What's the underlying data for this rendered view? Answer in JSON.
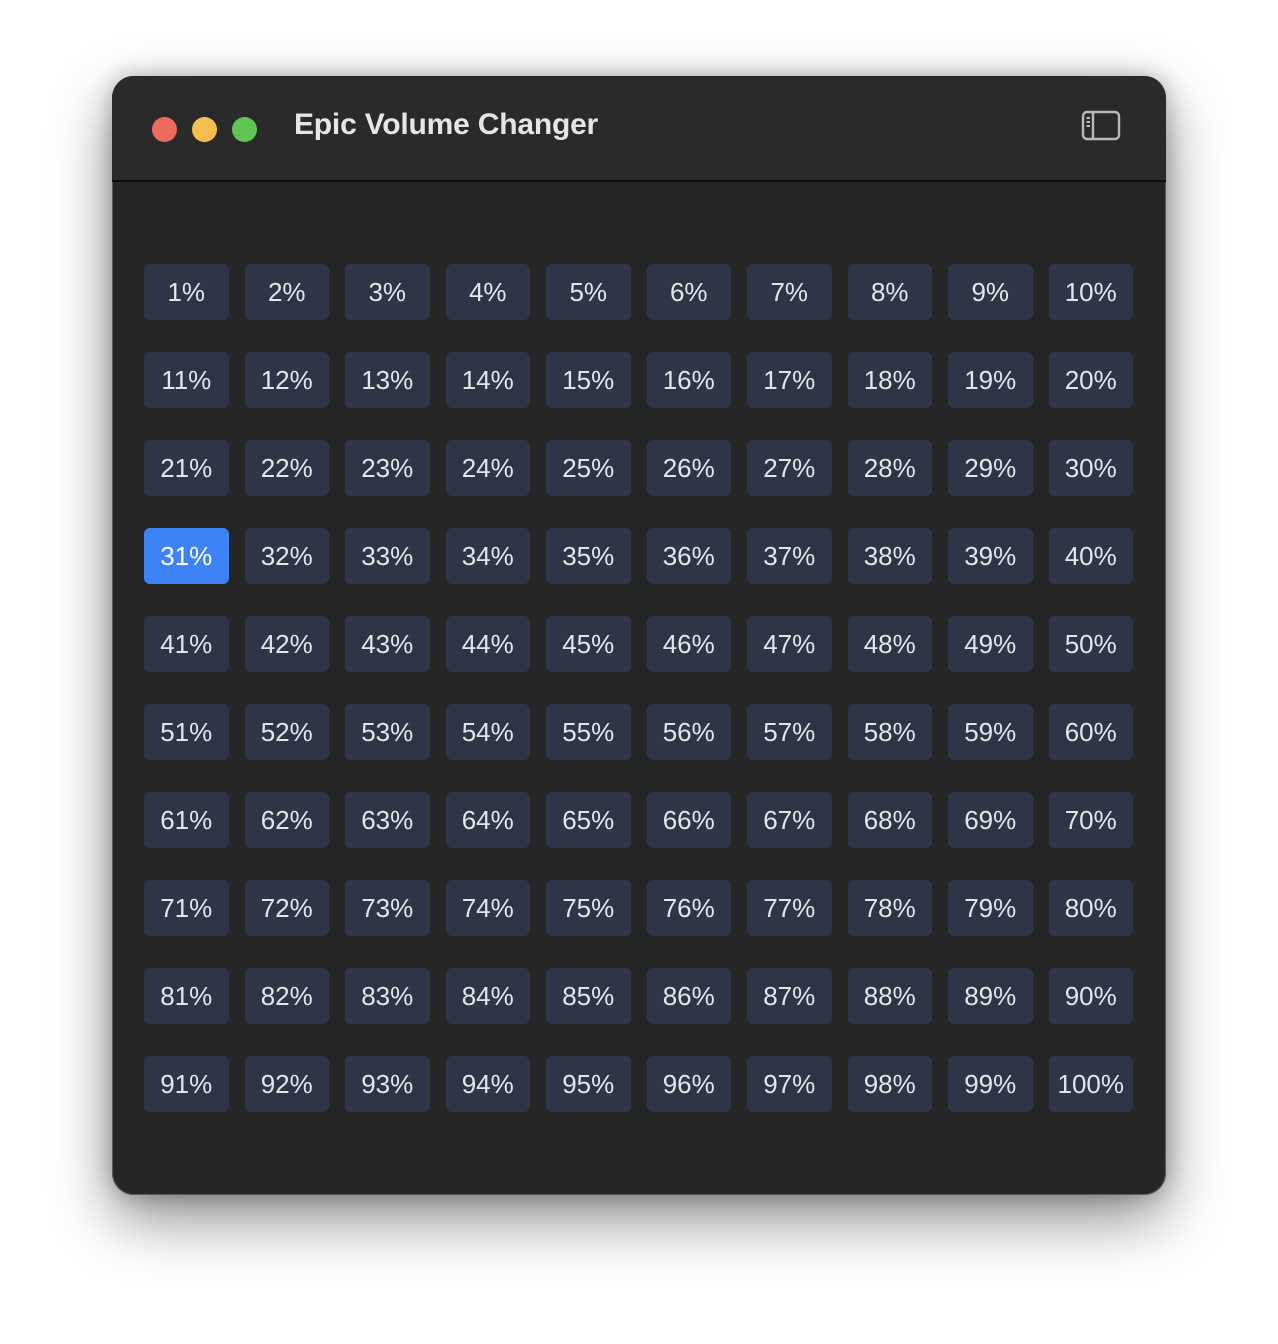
{
  "window": {
    "title": "Epic Volume Changer"
  },
  "toolbar": {
    "sidebar_toggle_icon": "sidebar-left-icon"
  },
  "colors": {
    "button_bg": "#2e3546",
    "selected_bg": "#3d82f7",
    "close": "#ed6a5e",
    "minimize": "#f5bf4f",
    "zoom": "#61c554"
  },
  "volume": {
    "selected": "31%",
    "options": [
      "1%",
      "2%",
      "3%",
      "4%",
      "5%",
      "6%",
      "7%",
      "8%",
      "9%",
      "10%",
      "11%",
      "12%",
      "13%",
      "14%",
      "15%",
      "16%",
      "17%",
      "18%",
      "19%",
      "20%",
      "21%",
      "22%",
      "23%",
      "24%",
      "25%",
      "26%",
      "27%",
      "28%",
      "29%",
      "30%",
      "31%",
      "32%",
      "33%",
      "34%",
      "35%",
      "36%",
      "37%",
      "38%",
      "39%",
      "40%",
      "41%",
      "42%",
      "43%",
      "44%",
      "45%",
      "46%",
      "47%",
      "48%",
      "49%",
      "50%",
      "51%",
      "52%",
      "53%",
      "54%",
      "55%",
      "56%",
      "57%",
      "58%",
      "59%",
      "60%",
      "61%",
      "62%",
      "63%",
      "64%",
      "65%",
      "66%",
      "67%",
      "68%",
      "69%",
      "70%",
      "71%",
      "72%",
      "73%",
      "74%",
      "75%",
      "76%",
      "77%",
      "78%",
      "79%",
      "80%",
      "81%",
      "82%",
      "83%",
      "84%",
      "85%",
      "86%",
      "87%",
      "88%",
      "89%",
      "90%",
      "91%",
      "92%",
      "93%",
      "94%",
      "95%",
      "96%",
      "97%",
      "98%",
      "99%",
      "100%"
    ]
  }
}
